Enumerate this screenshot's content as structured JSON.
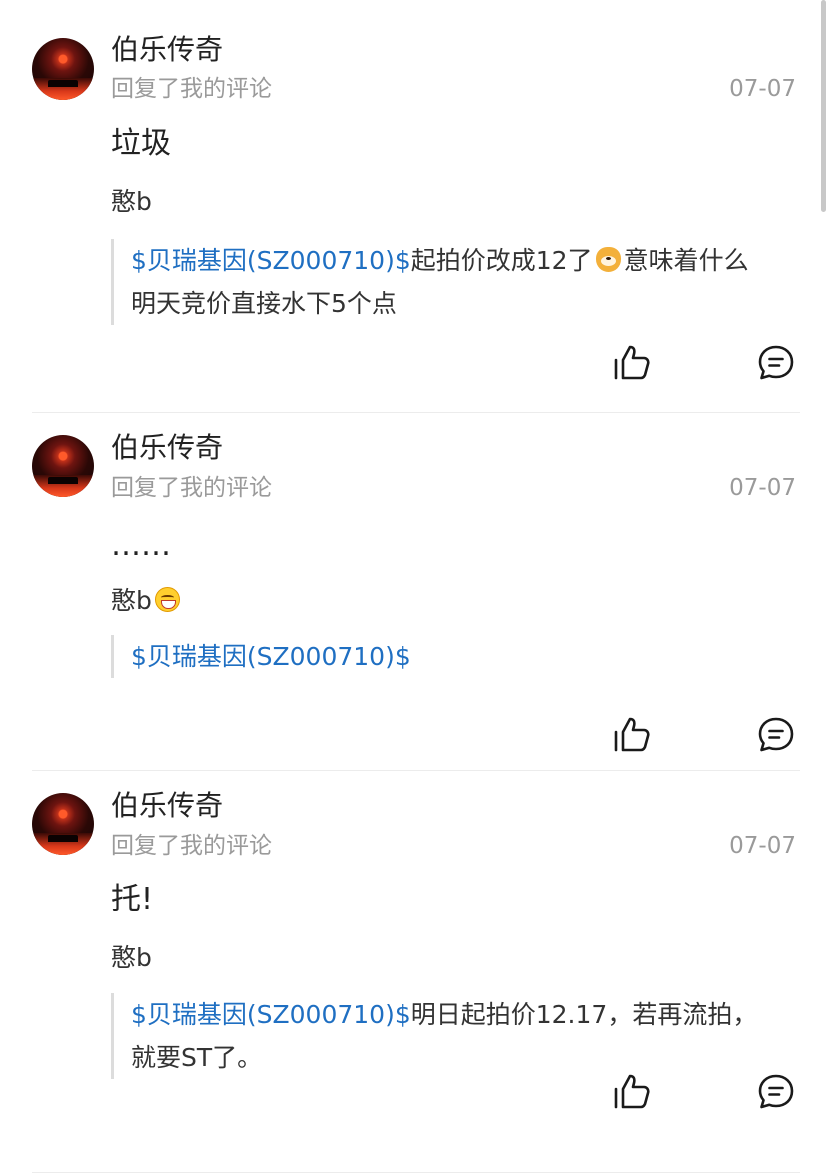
{
  "feed": [
    {
      "user_name": "伯乐传奇",
      "subtitle": "回复了我的评论",
      "date": "07-07",
      "reply_text": "垃圾",
      "quote_author": "憨b",
      "quote_stock": "$贝瑞基因(SZ000710)$",
      "quote_text_1": "起拍价改成12了",
      "quote_text_2": "意味着什么",
      "quote_text_3": "明天竞价直接水下5个点"
    },
    {
      "user_name": "伯乐传奇",
      "subtitle": "回复了我的评论",
      "date": "07-07",
      "reply_text": "……",
      "quote_author": "憨b",
      "quote_stock": "$贝瑞基因(SZ000710)$"
    },
    {
      "user_name": "伯乐传奇",
      "subtitle": "回复了我的评论",
      "date": "07-07",
      "reply_text": "托!",
      "quote_author": "憨b",
      "quote_stock": "$贝瑞基因(SZ000710)$",
      "quote_text_1": "明日起拍价12.17，若再流拍，",
      "quote_text_2": "就要ST了。"
    }
  ],
  "icons": {
    "like": "thumbs-up-outline",
    "comment": "speech-bubble-outline",
    "emoji_grin": "grinning-face",
    "emoji_dog": "doge-face"
  },
  "colors": {
    "stock_link": "#1f6fc2",
    "meta_gray": "#9a9a9a",
    "text": "#222222",
    "quote_bar": "#dcdcdc"
  }
}
